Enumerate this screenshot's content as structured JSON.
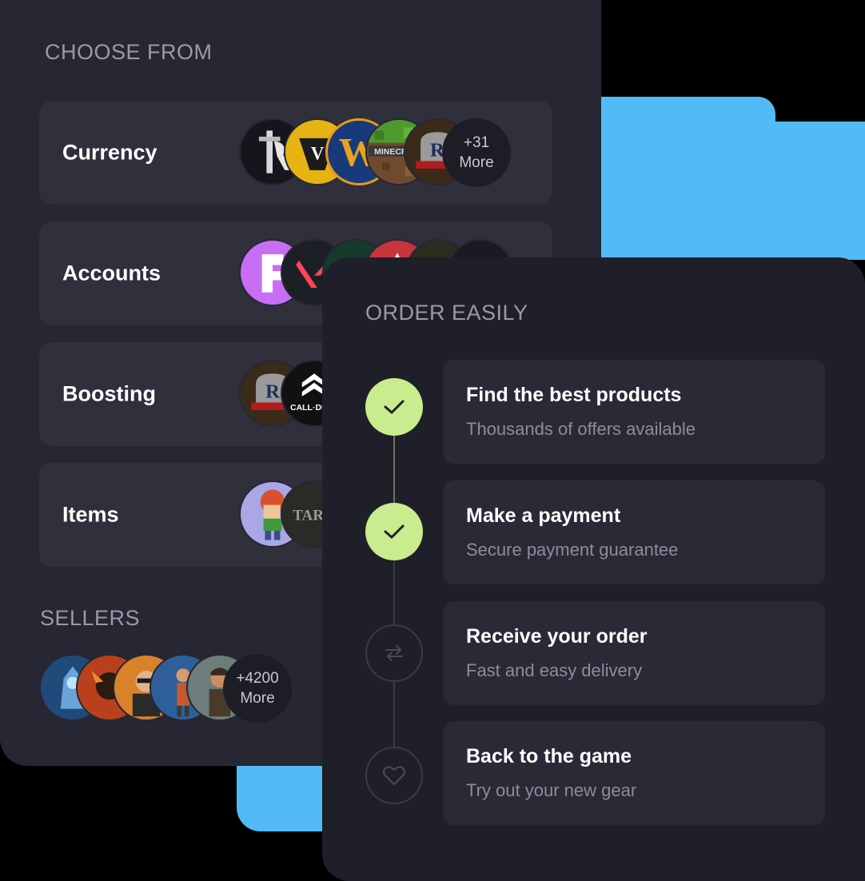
{
  "colors": {
    "accent_blue": "#52baf5",
    "accent_green": "#c8ec8e",
    "panel_back": "#272733",
    "panel_front": "#1f1f29",
    "card": "#30303c"
  },
  "choose_from": {
    "heading": "CHOOSE FROM",
    "categories": [
      {
        "label": "Currency",
        "more": {
          "count": "+31",
          "label": "More"
        },
        "icons": [
          "runescape-icon",
          "gta-v-icon",
          "world-of-warcraft-icon",
          "minecraft-icon",
          "old-school-runescape-icon"
        ]
      },
      {
        "label": "Accounts",
        "icons": [
          "fortnite-icon",
          "valorant-icon",
          "game-icon",
          "apex-legends-icon",
          "game-icon",
          "game-icon"
        ]
      },
      {
        "label": "Boosting",
        "icons": [
          "old-school-runescape-icon",
          "call-of-duty-icon"
        ]
      },
      {
        "label": "Items",
        "icons": [
          "growtopia-icon",
          "escape-from-tarkov-icon"
        ]
      }
    ]
  },
  "sellers": {
    "heading": "SELLERS",
    "more": {
      "count": "+4200",
      "label": "More"
    }
  },
  "order_easily": {
    "heading": "ORDER EASILY",
    "steps": [
      {
        "title": "Find the best products",
        "subtitle": "Thousands of offers available",
        "icon": "check-icon",
        "done": true
      },
      {
        "title": "Make a payment",
        "subtitle": "Secure payment guarantee",
        "icon": "check-icon",
        "done": true
      },
      {
        "title": "Receive your order",
        "subtitle": "Fast and easy delivery",
        "icon": "exchange-arrows-icon",
        "done": false
      },
      {
        "title": "Back to the game",
        "subtitle": "Try out your new gear",
        "icon": "heart-icon",
        "done": false
      }
    ]
  }
}
